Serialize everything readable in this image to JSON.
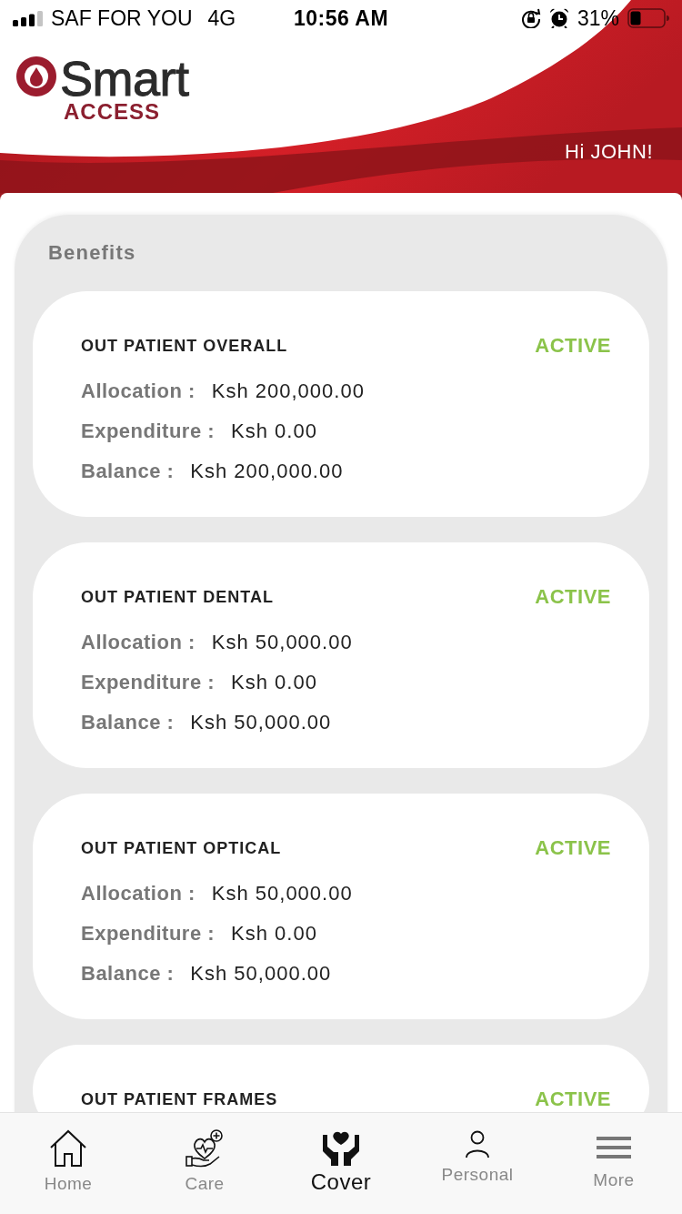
{
  "status_bar": {
    "carrier": "SAF FOR YOU",
    "network": "4G",
    "time": "10:56 AM",
    "battery": "31%"
  },
  "header": {
    "logo_title": "Smart",
    "logo_subtitle": "ACCESS",
    "greeting": "Hi JOHN!"
  },
  "benefits": {
    "title": "Benefits",
    "cards": [
      {
        "name": "OUT PATIENT OVERALL",
        "status": "ACTIVE",
        "rows": [
          {
            "label": "Allocation :",
            "value": "Ksh 200,000.00"
          },
          {
            "label": "Expenditure :",
            "value": "Ksh 0.00"
          },
          {
            "label": "Balance :",
            "value": "Ksh 200,000.00"
          }
        ]
      },
      {
        "name": "OUT PATIENT DENTAL",
        "status": "ACTIVE",
        "rows": [
          {
            "label": "Allocation :",
            "value": "Ksh 50,000.00"
          },
          {
            "label": "Expenditure :",
            "value": "Ksh 0.00"
          },
          {
            "label": "Balance :",
            "value": "Ksh 50,000.00"
          }
        ]
      },
      {
        "name": "OUT PATIENT OPTICAL",
        "status": "ACTIVE",
        "rows": [
          {
            "label": "Allocation :",
            "value": "Ksh 50,000.00"
          },
          {
            "label": "Expenditure :",
            "value": "Ksh 0.00"
          },
          {
            "label": "Balance :",
            "value": "Ksh 50,000.00"
          }
        ]
      },
      {
        "name": "OUT PATIENT FRAMES",
        "status": "ACTIVE"
      }
    ]
  },
  "tab_bar": [
    {
      "label": "Home",
      "selected": false
    },
    {
      "label": "Care",
      "selected": false
    },
    {
      "label": "Cover",
      "selected": true
    },
    {
      "label": "Personal",
      "selected": false
    },
    {
      "label": "More",
      "selected": false
    }
  ]
}
